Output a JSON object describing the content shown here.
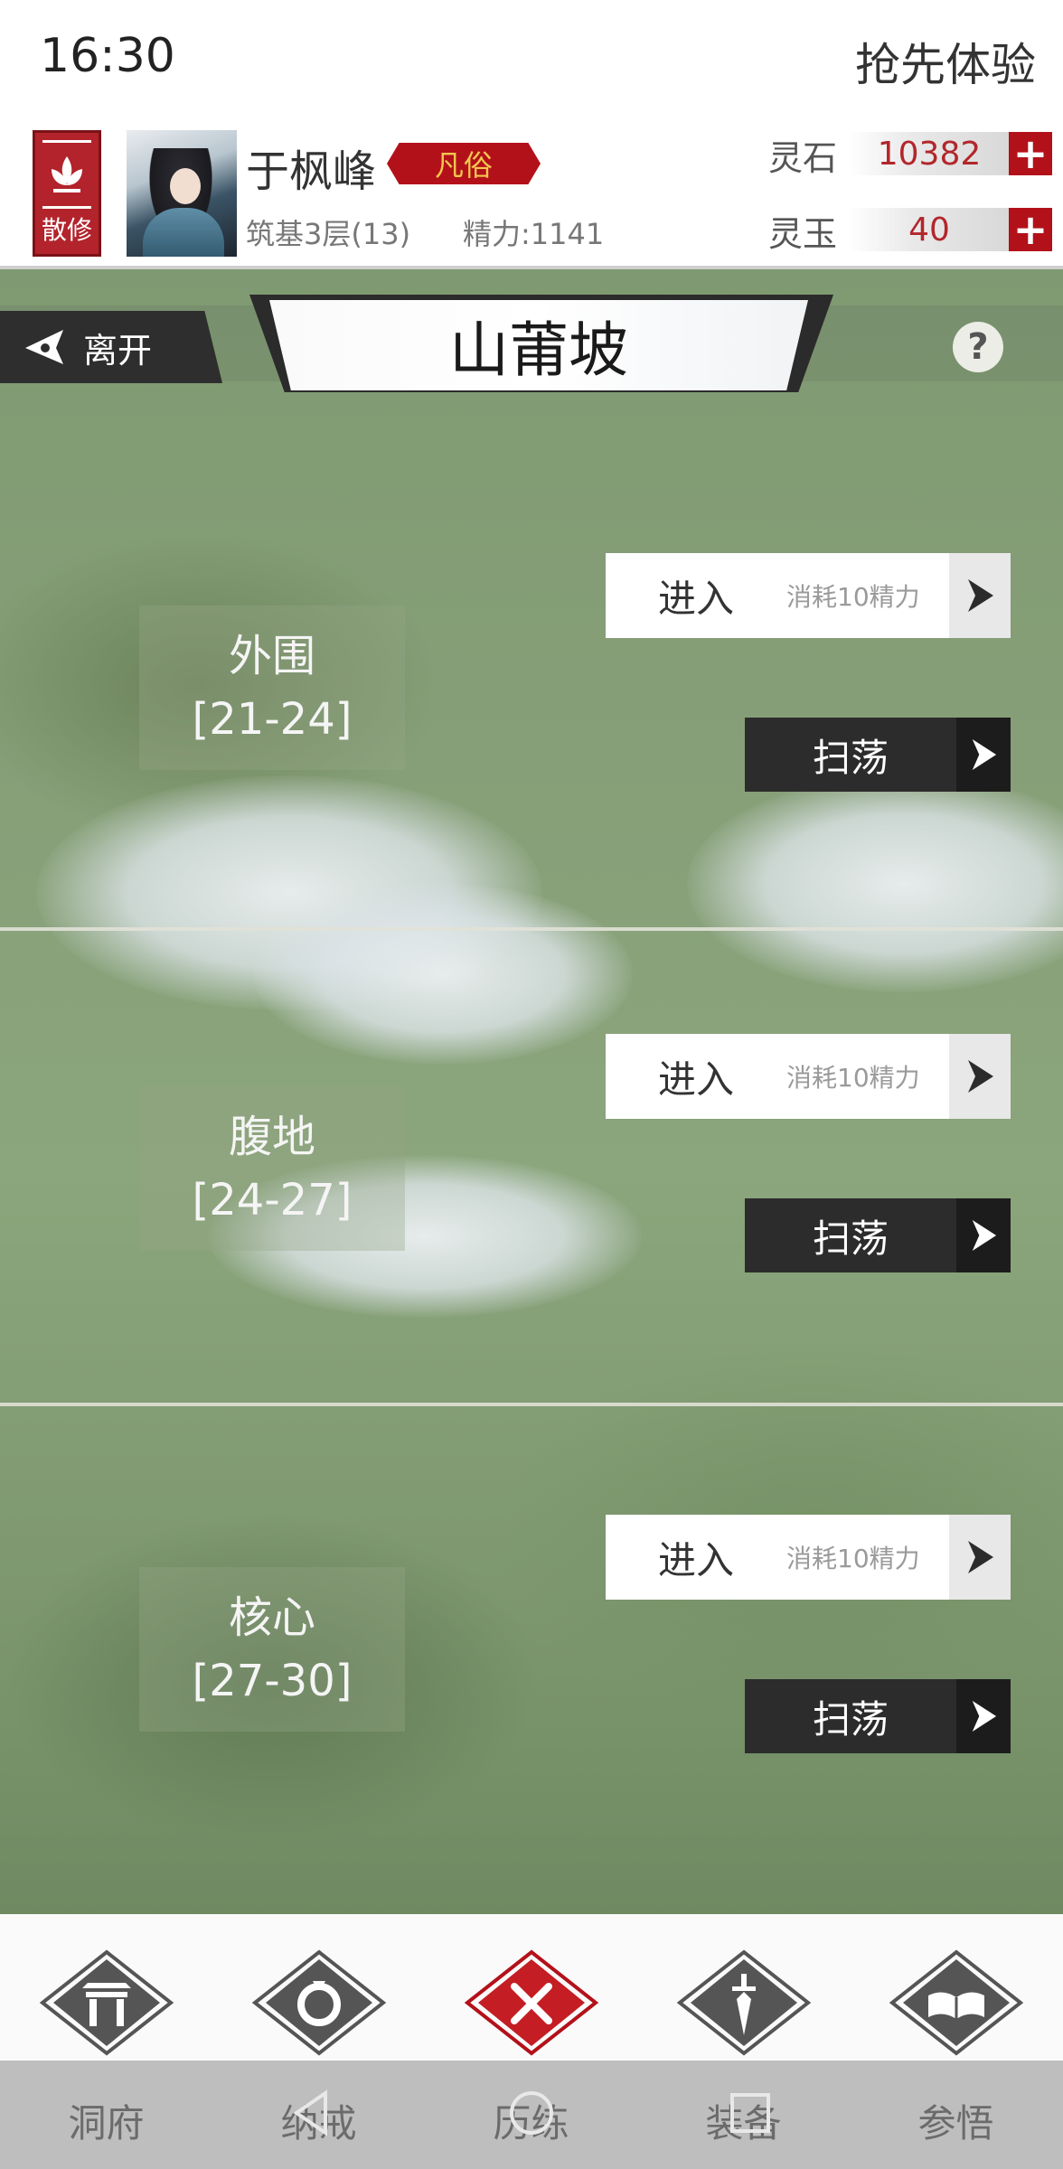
{
  "status": {
    "time": "16:30",
    "right_text": "抢先体验"
  },
  "player": {
    "sect": "散修",
    "name": "于枫峰",
    "rank": "凡俗",
    "realm": "筑基3层(13)",
    "energy": "精力:1141"
  },
  "currency": [
    {
      "label": "灵石",
      "value": "10382",
      "plus": "+"
    },
    {
      "label": "灵玉",
      "value": "40",
      "plus": "+"
    }
  ],
  "map": {
    "leave_label": "离开",
    "title": "山莆坡",
    "help": "?",
    "zones": [
      {
        "name": "外围",
        "range": "[21-24]",
        "enter": "进入",
        "cost": "消耗10精力",
        "sweep": "扫荡"
      },
      {
        "name": "腹地",
        "range": "[24-27]",
        "enter": "进入",
        "cost": "消耗10精力",
        "sweep": "扫荡"
      },
      {
        "name": "核心",
        "range": "[27-30]",
        "enter": "进入",
        "cost": "消耗10精力",
        "sweep": "扫荡"
      }
    ]
  },
  "nav": [
    {
      "label": "洞府",
      "icon": "gate-icon",
      "active": false
    },
    {
      "label": "纳戒",
      "icon": "ring-icon",
      "active": false
    },
    {
      "label": "历练",
      "icon": "crossed-swords-icon",
      "active": true
    },
    {
      "label": "装备",
      "icon": "dagger-icon",
      "active": false
    },
    {
      "label": "参悟",
      "icon": "book-icon",
      "active": false
    }
  ],
  "colors": {
    "accent_red": "#b3111a",
    "gold": "#f3c64f",
    "dark_button": "#2c2c2c",
    "nav_gray": "#555555"
  }
}
